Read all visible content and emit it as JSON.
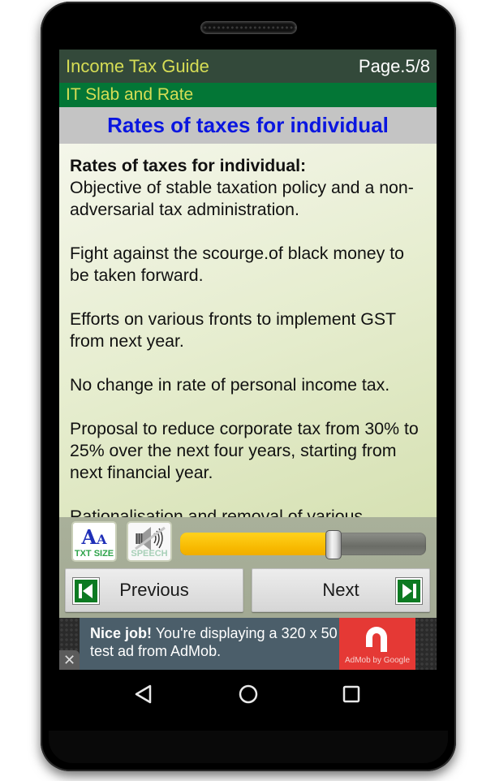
{
  "app": {
    "title": "Income Tax Guide",
    "page_indicator": "Page.5/8",
    "section": "IT Slab and Rate"
  },
  "heading": "Rates of taxes for individual",
  "content": {
    "bold_title": "Rates of taxes for individual:",
    "paragraphs": [
      "Objective of stable taxation policy and a non-adversarial tax administration.",
      "Fight against the scourge.of black money to be taken forward.",
      "Efforts on various fronts to implement GST from next year.",
      "No change in rate of personal income tax.",
      "Proposal to reduce corporate tax from 30% to 25% over the next four years, starting from next financial year."
    ],
    "truncated_line": "Rationalisation and removal of various"
  },
  "controls": {
    "text_size_button": {
      "glyph_big": "A",
      "glyph_small": "A",
      "label": "TXT SIZE",
      "icon": "text-size-icon"
    },
    "speech_button": {
      "label": "SPEECH",
      "icon": "speaker-muted-icon",
      "state": "off"
    },
    "text_size_slider": {
      "value_fraction": 0.62
    }
  },
  "navigation": {
    "previous_label": "Previous",
    "next_label": "Next",
    "previous_icon": "skip-previous-icon",
    "next_icon": "skip-next-icon"
  },
  "ad": {
    "headline_bold": "Nice job!",
    "text": " You're displaying a 320 x 50 test ad from AdMob.",
    "logo_caption": "AdMob by Google",
    "close_glyph": "✕"
  },
  "system_nav": {
    "back_icon": "back-icon",
    "home_icon": "home-icon",
    "recents_icon": "recents-icon"
  },
  "colors": {
    "titlebar_bg": "#33493a",
    "subbar_bg": "#037636",
    "title_text": "#d6dd55",
    "heading_text": "#0a16e0",
    "slider_fill": "#f7b800",
    "ad_red": "#e53935"
  }
}
